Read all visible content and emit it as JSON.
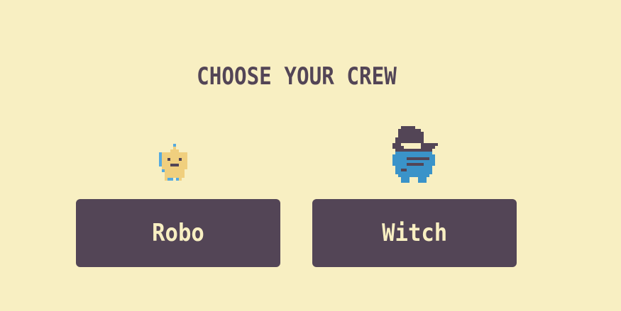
{
  "screen": {
    "title": "CHOOSE YOUR CREW"
  },
  "crew": [
    {
      "id": "robo",
      "label": "Robo",
      "sprite": "robot-sprite-icon"
    },
    {
      "id": "witch",
      "label": "Witch",
      "sprite": "witch-sprite-icon"
    }
  ],
  "colors": {
    "background": "#f8efc2",
    "button": "#534556",
    "button_text": "#f8efc2",
    "title_text": "#534556",
    "robot_body": "#f0cf7e",
    "robot_accent": "#56aadf",
    "witch_hat": "#534556",
    "witch_body": "#3a93c9",
    "witch_band": "#f8efc2"
  }
}
